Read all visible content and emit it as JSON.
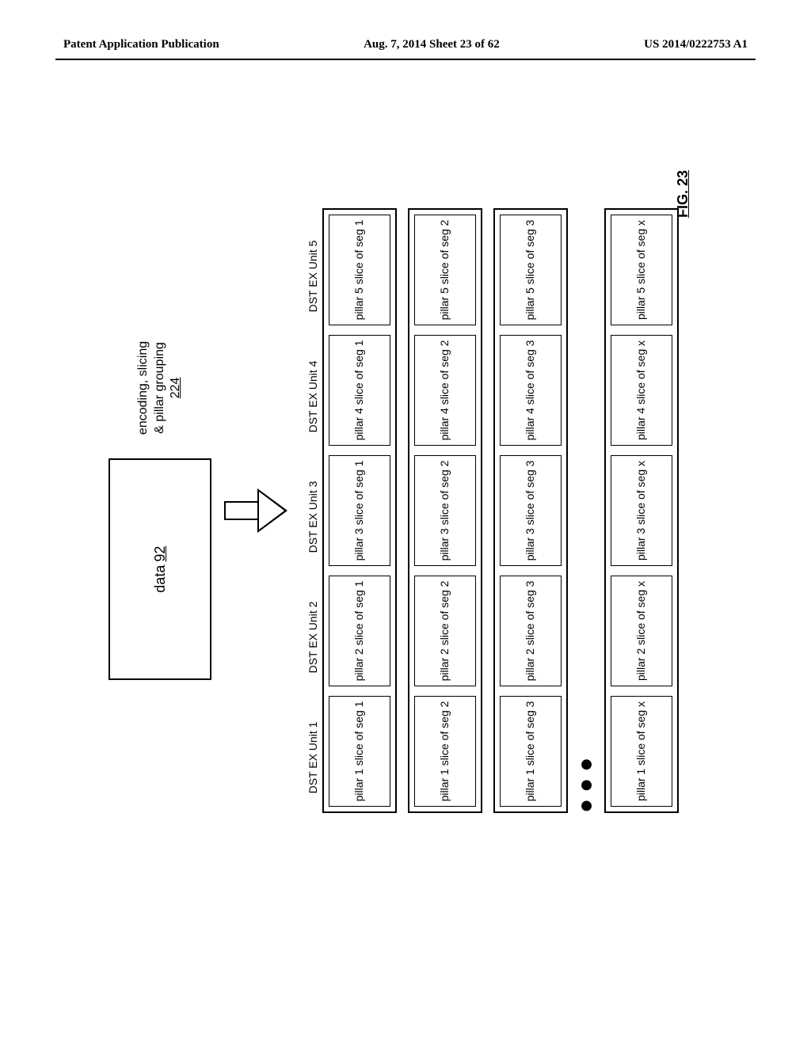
{
  "header": {
    "left": "Patent Application Publication",
    "center": "Aug. 7, 2014  Sheet 23 of 62",
    "right": "US 2014/0222753 A1"
  },
  "data_box": {
    "label": "data",
    "num": "92"
  },
  "process": {
    "line1": "encoding, slicing",
    "line2": "& pillar grouping",
    "num": "224"
  },
  "columns": [
    "DST EX Unit 1",
    "DST EX Unit 2",
    "DST EX Unit 3",
    "DST EX Unit 4",
    "DST EX Unit 5"
  ],
  "rows": [
    {
      "seg": "1",
      "cells": [
        "pillar 1 slice of seg 1",
        "pillar 2 slice of seg 1",
        "pillar 3 slice of seg 1",
        "pillar 4 slice of seg 1",
        "pillar 5 slice of seg 1"
      ]
    },
    {
      "seg": "2",
      "cells": [
        "pillar 1 slice of seg 2",
        "pillar 2 slice of seg 2",
        "pillar 3 slice of seg 2",
        "pillar 4 slice of seg 2",
        "pillar 5 slice of seg 2"
      ]
    },
    {
      "seg": "3",
      "cells": [
        "pillar 1 slice of seg 3",
        "pillar 2 slice of seg 3",
        "pillar 3 slice of seg 3",
        "pillar 4 slice of seg 3",
        "pillar 5 slice of seg 3"
      ]
    },
    {
      "seg": "x",
      "cells": [
        "pillar 1 slice of seg x",
        "pillar 2 slice of seg x",
        "pillar 3 slice of seg x",
        "pillar 4 slice of seg x",
        "pillar 5 slice of seg x"
      ]
    }
  ],
  "ellipsis": "●●●",
  "figure_label": "FIG. 23"
}
